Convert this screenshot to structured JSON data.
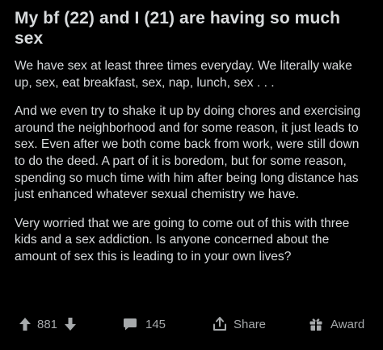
{
  "post": {
    "title": "My bf (22) and I (21) are having so much sex",
    "paragraphs": [
      "We have sex at least three times everyday. We literally wake up, sex, eat breakfast, sex, nap, lunch, sex . . .",
      "And we even try to shake it up by doing chores and exercising around the neighborhood and for some reason, it just leads to sex. Even after we both come back from work, were still down to do the deed. A part of it is boredom, but for some reason, spending so much time with him after being long distance has just enhanced whatever sexual chemistry we have.",
      "Very worried that we are going to come out of this with three kids and a sex addiction. Is anyone concerned about the amount of sex this is leading to in your own lives?"
    ]
  },
  "actions": {
    "upvote_icon": "arrow-up-icon",
    "score": "881",
    "downvote_icon": "arrow-down-icon",
    "comment_icon": "comment-bubble-icon",
    "comment_count": "145",
    "share_icon": "share-upload-icon",
    "share_label": "Share",
    "award_icon": "gift-award-icon",
    "award_label": "Award"
  },
  "colors": {
    "background": "#000000",
    "text": "#d7dadc",
    "icon_text": "#a6a9ab"
  }
}
